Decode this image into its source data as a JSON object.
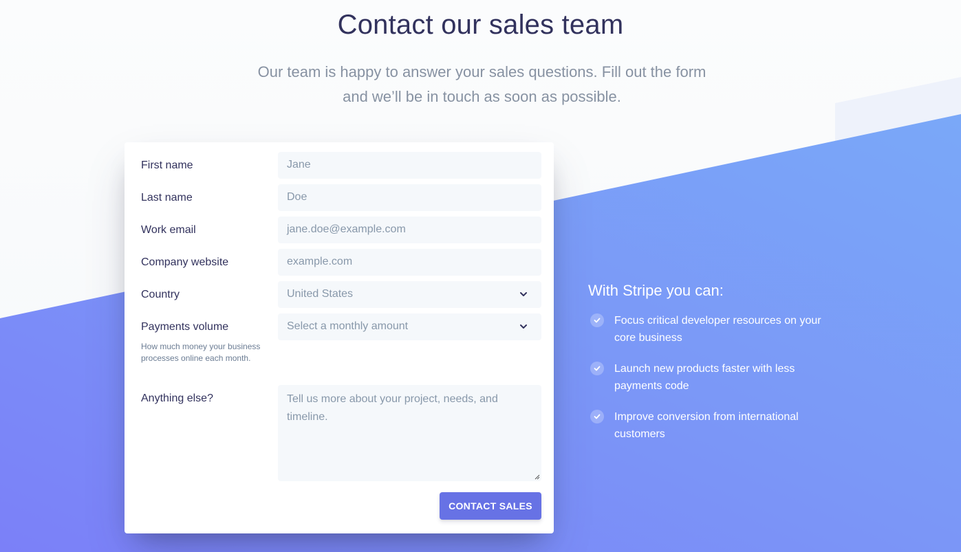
{
  "header": {
    "title": "Contact our sales team",
    "subtitle": "Our team is happy to answer your sales questions. Fill out the form and we’ll be in touch as soon as possible."
  },
  "form": {
    "first_name": {
      "label": "First name",
      "placeholder": "Jane"
    },
    "last_name": {
      "label": "Last name",
      "placeholder": "Doe"
    },
    "work_email": {
      "label": "Work email",
      "placeholder": "jane.doe@example.com"
    },
    "company_website": {
      "label": "Company website",
      "placeholder": "example.com"
    },
    "country": {
      "label": "Country",
      "value": "United States"
    },
    "payments_volume": {
      "label": "Payments volume",
      "value": "Select a monthly amount",
      "hint": "How much money your business processes online each month."
    },
    "anything_else": {
      "label": "Anything else?",
      "placeholder": "Tell us more about your project, needs, and timeline."
    },
    "submit_label": "CONTACT SALES"
  },
  "side": {
    "heading": "With Stripe you can:",
    "benefits": [
      "Focus critical developer resources on your core business",
      "Launch new products faster with less payments code",
      "Improve conversion from international customers"
    ]
  },
  "colors": {
    "accent": "#6772e5",
    "text": "#32325d",
    "muted": "#8792a2",
    "gradient_start": "#7a7ff7",
    "gradient_end": "#7aa4f7"
  }
}
